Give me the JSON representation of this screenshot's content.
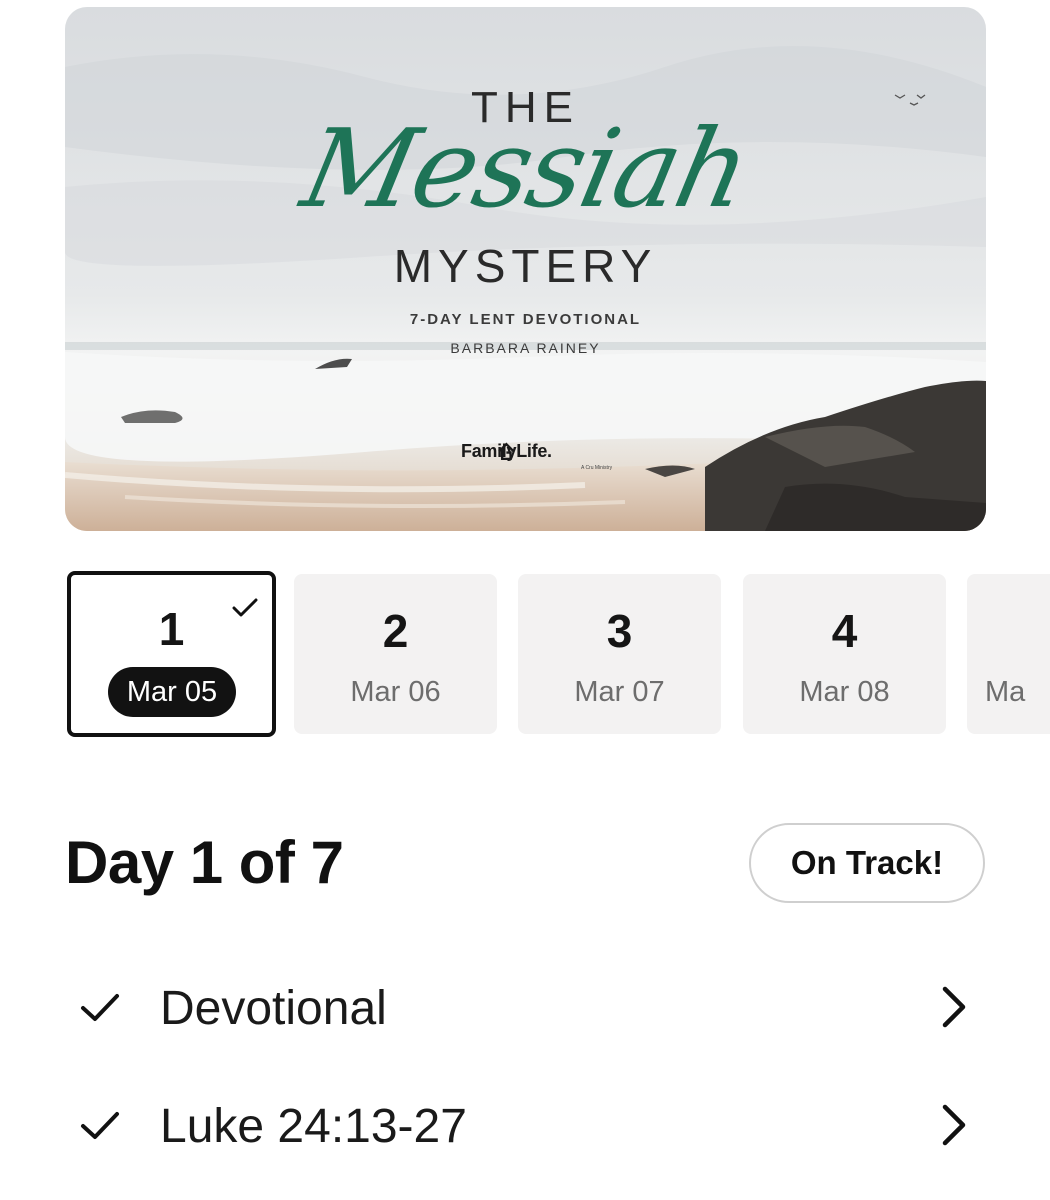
{
  "hero": {
    "title_top": "THE",
    "title_script": "Messiah",
    "title_bottom": "MYSTERY",
    "subtitle": "7-DAY LENT DEVOTIONAL",
    "author": "BARBARA RAINEY",
    "logo_text": "FamilyLife.",
    "logo_tagline": "A Cru Ministry"
  },
  "days": [
    {
      "number": "1",
      "date": "Mar 05",
      "selected": true,
      "completed": true
    },
    {
      "number": "2",
      "date": "Mar 06",
      "selected": false,
      "completed": false
    },
    {
      "number": "3",
      "date": "Mar 07",
      "selected": false,
      "completed": false
    },
    {
      "number": "4",
      "date": "Mar 08",
      "selected": false,
      "completed": false
    },
    {
      "number": "",
      "date": "Ma",
      "selected": false,
      "completed": false
    }
  ],
  "day_header": {
    "title": "Day 1 of 7",
    "status_button": "On Track!"
  },
  "tasks": [
    {
      "label": "Devotional",
      "completed": true,
      "icon": "checkmark-icon"
    },
    {
      "label": "Luke 24:13-27",
      "completed": true,
      "icon": "checkmark-icon"
    }
  ],
  "colors": {
    "accent_green": "#1e7457",
    "selected_pill": "#121212",
    "card_background": "#f3f2f2"
  }
}
